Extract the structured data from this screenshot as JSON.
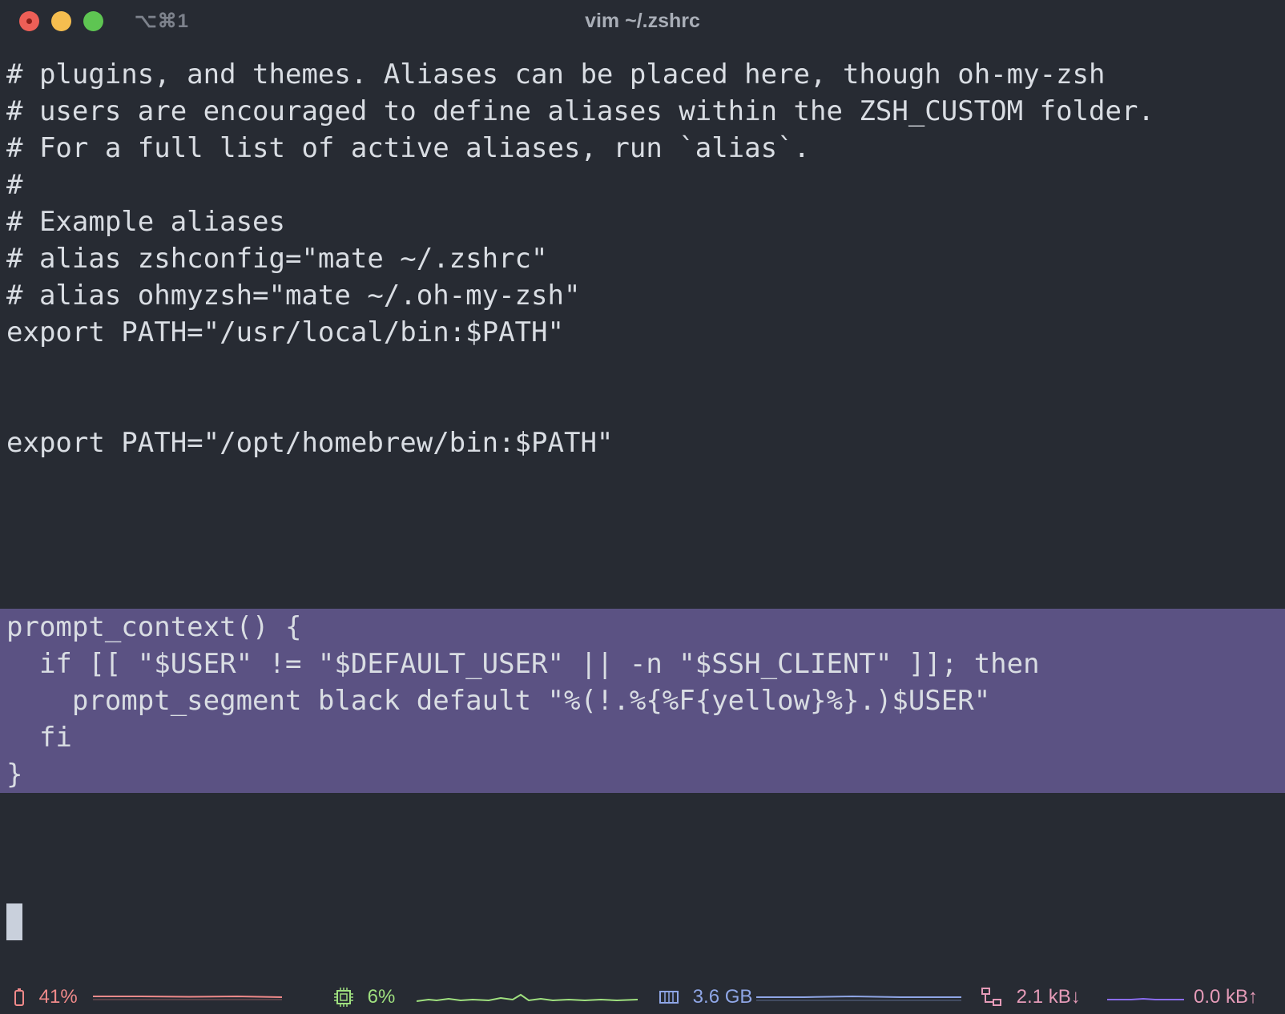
{
  "window": {
    "tab_shortcut": "⌥⌘1",
    "title": "vim ~/.zshrc"
  },
  "editor": {
    "lines": [
      "# plugins, and themes. Aliases can be placed here, though oh-my-zsh",
      "# users are encouraged to define aliases within the ZSH_CUSTOM folder.",
      "# For a full list of active aliases, run `alias`.",
      "#",
      "# Example aliases",
      "# alias zshconfig=\"mate ~/.zshrc\"",
      "# alias ohmyzsh=\"mate ~/.oh-my-zsh\"",
      "export PATH=\"/usr/local/bin:$PATH\"",
      "",
      "",
      "export PATH=\"/opt/homebrew/bin:$PATH\"",
      "",
      "",
      "",
      "",
      "prompt_context() {",
      "  if [[ \"$USER\" != \"$DEFAULT_USER\" || -n \"$SSH_CLIENT\" ]]; then",
      "    prompt_segment black default \"%(!.%{%F{yellow}%}.)$USER\"",
      "  fi",
      "}"
    ],
    "selected_from_line": 15,
    "selected_to_line": 19,
    "selection_color": "#5b5283"
  },
  "status_bar": {
    "battery": {
      "icon": "battery-icon",
      "value": "41%",
      "color": "#f08a8a"
    },
    "cpu": {
      "icon": "cpu-icon",
      "value": "6%",
      "color": "#9fe07f"
    },
    "memory": {
      "icon": "memory-icon",
      "value": "3.6 GB",
      "color": "#8fa6e6"
    },
    "network_down": {
      "icon": "network-icon",
      "value": "2.1 kB↓",
      "color": "#e59bb8"
    },
    "network_up": {
      "value": "0.0 kB↑",
      "color": "#e59bb8"
    }
  }
}
